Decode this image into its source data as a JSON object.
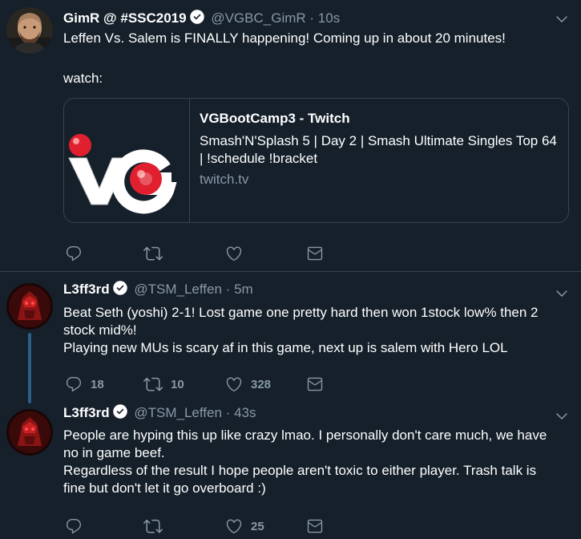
{
  "tweets": [
    {
      "name": "GimR @ #SSC2019",
      "handle": "@VGBC_GimR",
      "dot": "·",
      "time": "10s",
      "lines": [
        "Leffen Vs. Salem is FINALLY happening! Coming up in about 20 minutes!",
        "",
        "watch:"
      ],
      "card": {
        "title": "VGBootCamp3 - Twitch",
        "description": "Smash'N'Splash 5 | Day 2 | Smash Ultimate Singles Top 64 | !schedule !bracket",
        "domain": "twitch.tv",
        "logo_text": "VG"
      },
      "actions": {
        "reply": "",
        "retweet": "",
        "like": ""
      }
    },
    {
      "name": "L3ff3rd",
      "handle": "@TSM_Leffen",
      "dot": "·",
      "time": "5m",
      "lines": [
        "Beat Seth (yoshi) 2-1! Lost game one pretty hard then won 1stock low% then 2 stock mid%!",
        "Playing new MUs is scary af in this game, next up is salem with Hero LOL"
      ],
      "actions": {
        "reply": "18",
        "retweet": "10",
        "like": "328"
      }
    },
    {
      "name": "L3ff3rd",
      "handle": "@TSM_Leffen",
      "dot": "·",
      "time": "43s",
      "lines": [
        "People are hyping this up like crazy lmao. I personally don't care much, we have no in game beef.",
        "Regardless of the result I hope people aren't toxic to either player. Trash talk is fine but don't let it go overboard :)"
      ],
      "actions": {
        "reply": "",
        "retweet": "",
        "like": "25"
      }
    }
  ],
  "colors": {
    "background": "#15202b",
    "border": "#38444d",
    "muted": "#8899a6",
    "verified": "#ffffff",
    "thread": "#2c5f8a",
    "logo_red": "#e0202e"
  }
}
